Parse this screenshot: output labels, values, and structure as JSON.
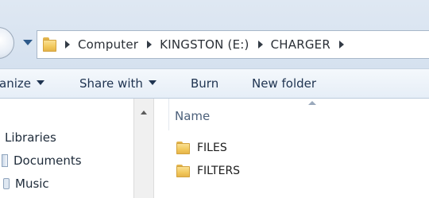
{
  "address_bar": {
    "breadcrumbs": [
      "Computer",
      "KINGSTON (E:)",
      "CHARGER"
    ],
    "folder_icon": "folder-icon"
  },
  "toolbar": {
    "organize_label": "anize",
    "share_with_label": "Share with",
    "burn_label": "Burn",
    "new_folder_label": "New folder"
  },
  "navigation_pane": {
    "items": [
      {
        "label": "Libraries",
        "icon": ""
      },
      {
        "label": "Documents",
        "icon": "document-library-icon"
      },
      {
        "label": "Music",
        "icon": "music-library-icon"
      }
    ]
  },
  "file_list": {
    "column_name": "Name",
    "files": [
      {
        "name": "FILES",
        "icon": "folder-icon"
      },
      {
        "name": "FILTERS",
        "icon": "folder-icon"
      }
    ]
  },
  "colors": {
    "address_bg": "#d5e1ef",
    "toolbar_bg": "#e6eef7",
    "folder_yellow": "#f1c75a",
    "text_dark": "#1e3350"
  }
}
